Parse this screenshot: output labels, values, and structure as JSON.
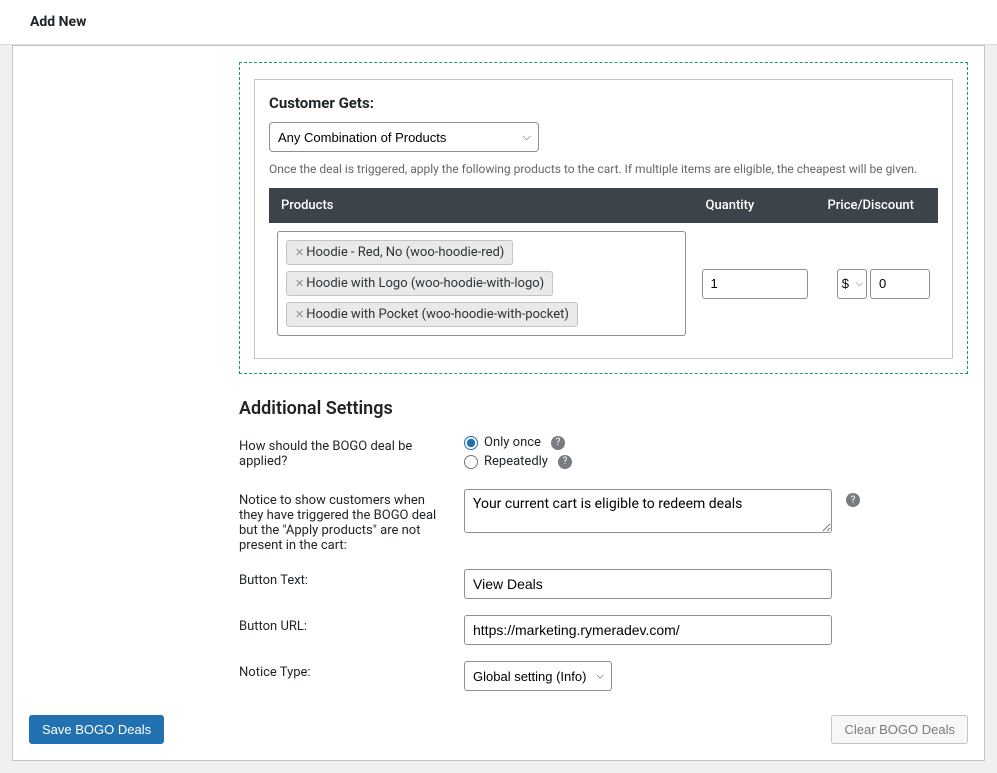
{
  "header": {
    "title": "Add New"
  },
  "customerGets": {
    "label": "Customer Gets:",
    "selectValue": "Any Combination of Products",
    "hint": "Once the deal is triggered, apply the following products to the cart. If multiple items are eligible, the cheapest will be given.",
    "columns": {
      "products": "Products",
      "quantity": "Quantity",
      "priceDiscount": "Price/Discount"
    },
    "products": [
      "Hoodie - Red, No (woo-hoodie-red)",
      "Hoodie with Logo (woo-hoodie-with-logo)",
      "Hoodie with Pocket (woo-hoodie-with-pocket)"
    ],
    "quantity": "1",
    "currency": "$",
    "price": "0"
  },
  "additional": {
    "heading": "Additional Settings",
    "applyLabel": "How should the BOGO deal be applied?",
    "applyOptions": {
      "once": "Only once",
      "repeatedly": "Repeatedly"
    },
    "noticeLabel": "Notice to show customers when they have triggered the BOGO deal but the \"Apply products\" are not present in the cart:",
    "noticeValue": "Your current cart is eligible to redeem deals",
    "buttonTextLabel": "Button Text:",
    "buttonTextValue": "View Deals",
    "buttonUrlLabel": "Button URL:",
    "buttonUrlValue": "https://marketing.rymeradev.com/",
    "noticeTypeLabel": "Notice Type:",
    "noticeTypeValue": "Global setting (Info)"
  },
  "footer": {
    "save": "Save BOGO Deals",
    "clear": "Clear BOGO Deals"
  }
}
